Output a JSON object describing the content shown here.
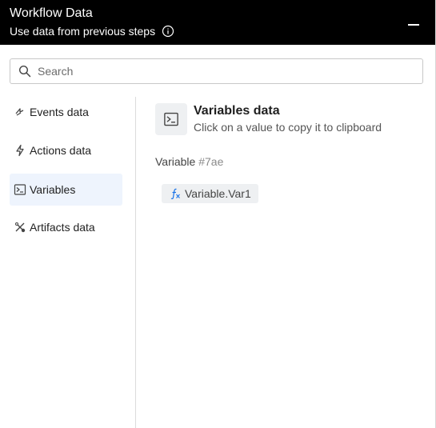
{
  "header": {
    "title": "Workflow Data",
    "subtitle": "Use data from previous steps"
  },
  "search": {
    "placeholder": "Search",
    "value": ""
  },
  "sidebar": {
    "items": [
      {
        "label": "Events data",
        "icon": "events-icon",
        "active": false
      },
      {
        "label": "Actions data",
        "icon": "lightning-icon",
        "active": false
      },
      {
        "label": "Variables",
        "icon": "terminal-icon",
        "active": true
      },
      {
        "label": "Artifacts data",
        "icon": "artifacts-icon",
        "active": false
      }
    ]
  },
  "content": {
    "title": "Variables data",
    "description": "Click on a value to copy it to clipboard",
    "variable_label": "Variable",
    "variable_id": "#7ae",
    "chip_label": "Variable.Var1"
  },
  "colors": {
    "header_bg": "#000000",
    "active_bg": "#eef4fd",
    "accent": "#1a73e8"
  }
}
